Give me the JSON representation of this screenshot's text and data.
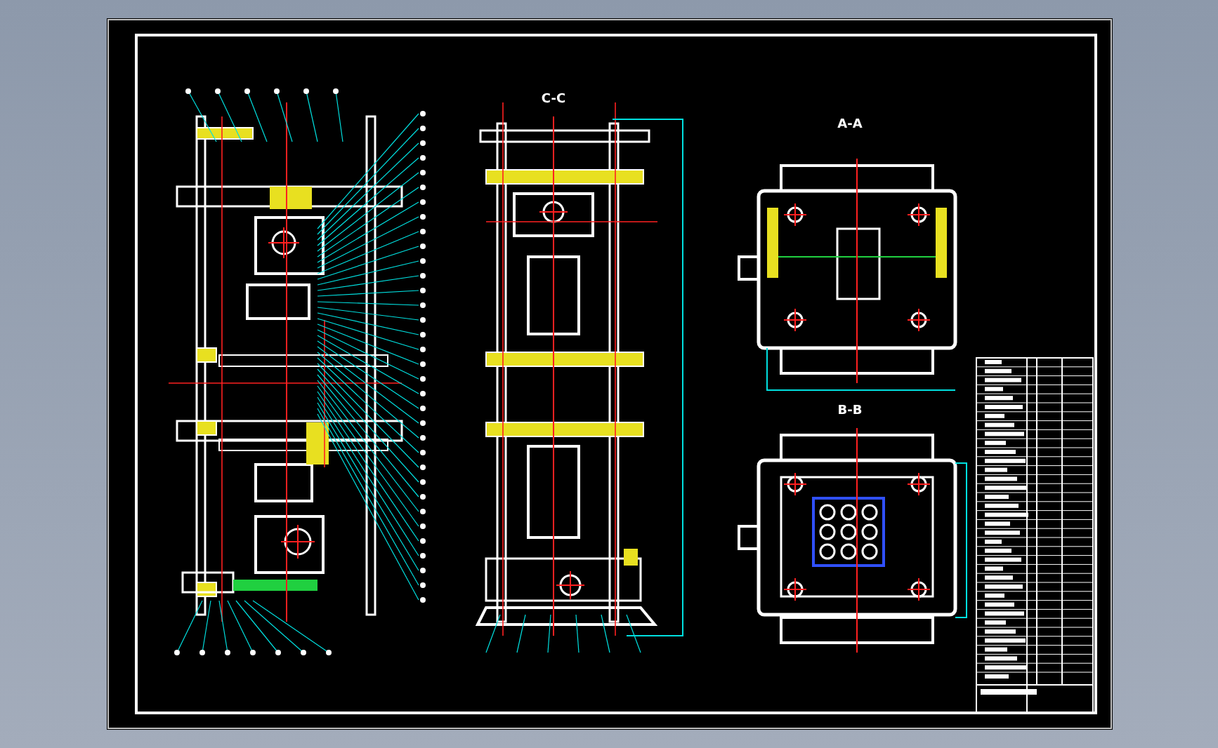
{
  "views": [
    {
      "label": "C-C"
    },
    {
      "label": "A-A"
    },
    {
      "label": "B-B"
    }
  ]
}
